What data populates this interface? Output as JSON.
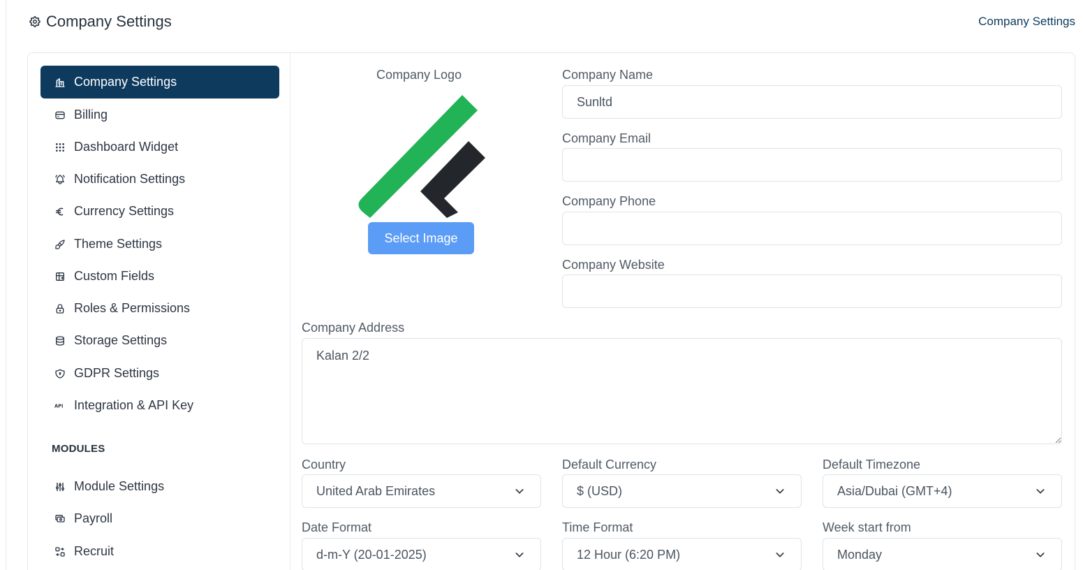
{
  "header": {
    "title": "Company Settings",
    "title_icon": "gear-icon",
    "breadcrumb": "Company Settings"
  },
  "sidebar": {
    "items": [
      {
        "label": "Company Settings",
        "icon": "building-icon",
        "active": true
      },
      {
        "label": "Billing",
        "icon": "credit-card-icon"
      },
      {
        "label": "Dashboard Widget",
        "icon": "grid-dots-icon"
      },
      {
        "label": "Notification Settings",
        "icon": "bell-icon"
      },
      {
        "label": "Currency Settings",
        "icon": "euro-icon"
      },
      {
        "label": "Theme Settings",
        "icon": "brush-icon"
      },
      {
        "label": "Custom Fields",
        "icon": "table-icon"
      },
      {
        "label": "Roles & Permissions",
        "icon": "lock-icon"
      },
      {
        "label": "Storage Settings",
        "icon": "database-icon"
      },
      {
        "label": "GDPR Settings",
        "icon": "shield-icon"
      },
      {
        "label": "Integration & API Key",
        "icon": "api-icon"
      }
    ],
    "modules_heading": "MODULES",
    "modules": [
      {
        "label": "Module Settings",
        "icon": "sliders-icon"
      },
      {
        "label": "Payroll",
        "icon": "cash-icon"
      },
      {
        "label": "Recruit",
        "icon": "recruit-icon"
      }
    ]
  },
  "logo": {
    "label": "Company Logo",
    "button_label": "Select Image"
  },
  "form": {
    "company_name": {
      "label": "Company Name",
      "value": "Sunltd"
    },
    "company_email": {
      "label": "Company Email",
      "value": ""
    },
    "company_phone": {
      "label": "Company Phone",
      "value": ""
    },
    "company_website": {
      "label": "Company Website",
      "value": ""
    },
    "company_address": {
      "label": "Company Address",
      "value": "Kalan 2/2"
    },
    "country": {
      "label": "Country",
      "value": "United Arab Emirates"
    },
    "default_currency": {
      "label": "Default Currency",
      "value": "$ (USD)"
    },
    "default_timezone": {
      "label": "Default Timezone",
      "value": "Asia/Dubai (GMT+4)"
    },
    "date_format": {
      "label": "Date Format",
      "value": "d-m-Y (20-01-2025)"
    },
    "time_format": {
      "label": "Time Format",
      "value": "12 Hour (6:20 PM)"
    },
    "week_start": {
      "label": "Week start from",
      "value": "Monday"
    }
  },
  "colors": {
    "primary": "#0e3a5e",
    "button": "#5b9cf7",
    "logo_green": "#22b357",
    "logo_dark": "#23262b"
  }
}
